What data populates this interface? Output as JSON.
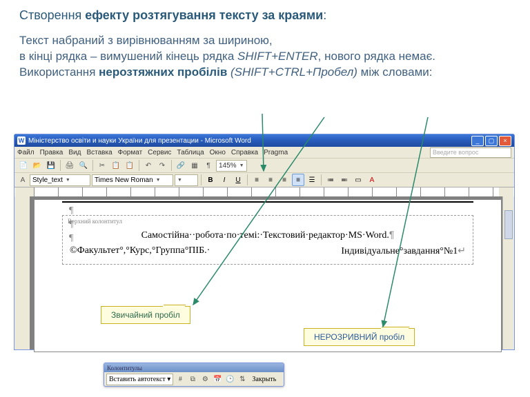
{
  "heading": {
    "prefix": "Створення ",
    "bold": "ефекту розтягування тексту за краями",
    "suffix": ":"
  },
  "desc": {
    "l1": "Текст набраний з вирівнюванням за шириною,",
    "l2a": "в кінці рядка – вимушений кінець рядка ",
    "l2em": "SHIFT+ENTER",
    "l2b": ", нового рядка немає.",
    "l3a": "Використання ",
    "l3b": "нерозтяжних пробілів",
    "l3em": " (SHIFT+CTRL+Пробел)",
    "l3c": " між словами:"
  },
  "word": {
    "title": "Міністерство освіти и науки України для презентации - Microsoft Word",
    "menus": [
      "Файл",
      "Правка",
      "Вид",
      "Вставка",
      "Формат",
      "Сервис",
      "Таблица",
      "Окно",
      "Справка",
      "Pragma"
    ],
    "question_placeholder": "Введите вопрос",
    "style_label": "Style_text",
    "font_label": "Times New Roman",
    "zoom": "145%",
    "tb_icons": [
      "📄",
      "📂",
      "💾",
      "🖨",
      "🔍",
      "✂",
      "📋",
      "📋",
      "↶",
      "↷",
      "🔗",
      "▦",
      "¶"
    ],
    "fmt_icons": [
      "B",
      "I",
      "U",
      "≡",
      "≡",
      "≡",
      "≡",
      "☰",
      "≔",
      "≕",
      "▭",
      "A"
    ],
    "header_label": "Верхний колонтитул",
    "line_center": "Самостійна··робота·по·темі:·Текстовий·редактор·MS·Word.",
    "line_left": "©Факультет°,°Курс,°Группа°ПІБ.·",
    "line_right": "Індивідуальне°завдання°№1",
    "para": "¶"
  },
  "callouts": {
    "regular": "Звичайний пробіл",
    "nbsp": "НЕРОЗРИВНИЙ пробіл"
  },
  "float_tb": {
    "title": "Колонтитулы",
    "autotext": "Вставить автотекст ▾",
    "close": "Закрыть"
  }
}
